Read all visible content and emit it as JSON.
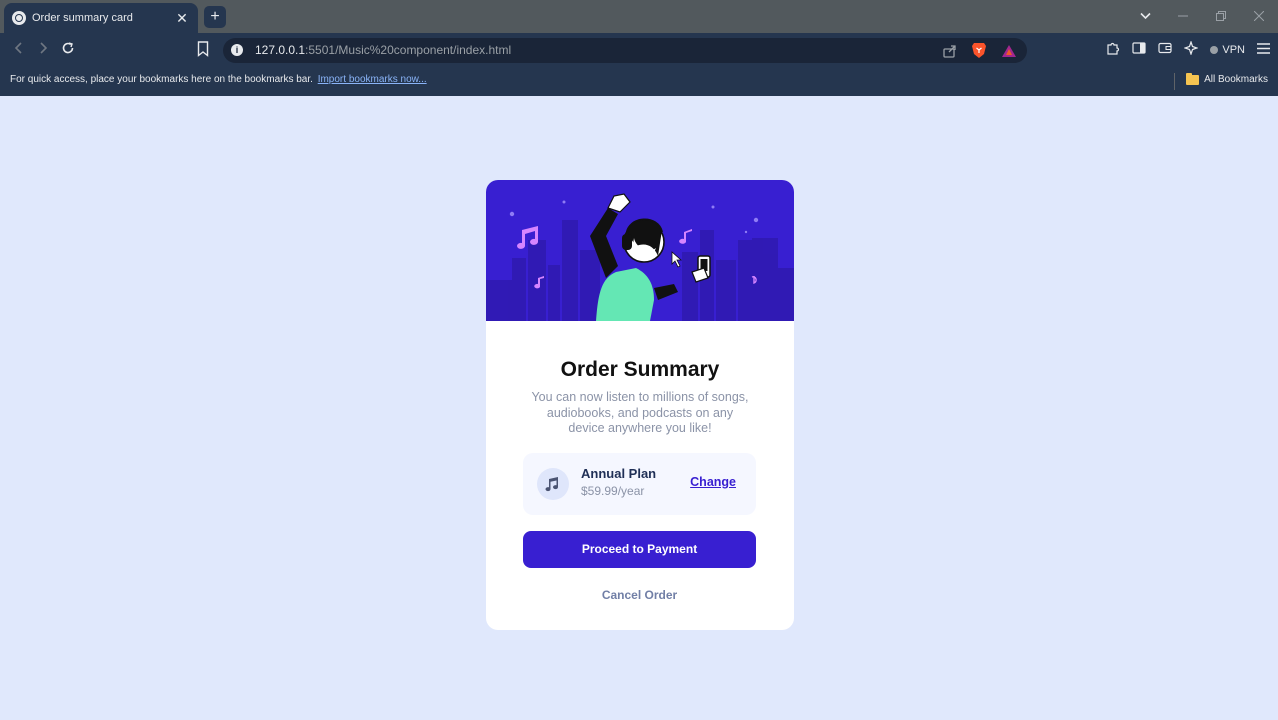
{
  "browser": {
    "tab_title": "Order summary card",
    "tab_close": "✕",
    "new_tab": "+",
    "url_host": "127.0.0.1",
    "url_rest": ":5501/Music%20component/index.html",
    "vpn_label": "VPN",
    "bookmarks_message": "For quick access, place your bookmarks here on the bookmarks bar.",
    "import_link": "Import bookmarks now...",
    "all_bookmarks": "All Bookmarks",
    "icons": {
      "back": "back-arrow-icon",
      "forward": "forward-arrow-icon",
      "reload": "reload-icon",
      "bookmark": "bookmark-icon",
      "share": "share-icon",
      "brave_shields": "brave-lion-icon",
      "rewards": "brave-rewards-triangle-icon",
      "extensions": "puzzle-icon",
      "sidebar": "sidebar-icon",
      "wallet": "wallet-icon",
      "leo": "leo-sparkle-icon",
      "menu": "hamburger-menu-icon"
    }
  },
  "card": {
    "title": "Order Summary",
    "description": "You can now listen to millions of songs, audiobooks, and podcasts on any device anywhere you like!",
    "plan_name": "Annual Plan",
    "plan_price": "$59.99/year",
    "change_label": "Change",
    "proceed_label": "Proceed to Payment",
    "cancel_label": "Cancel Order",
    "colors": {
      "hero_bg": "#381fd1",
      "accent": "#381fd1",
      "plan_bg": "#f5f7ff",
      "page_bg": "#e0e8fc"
    }
  }
}
